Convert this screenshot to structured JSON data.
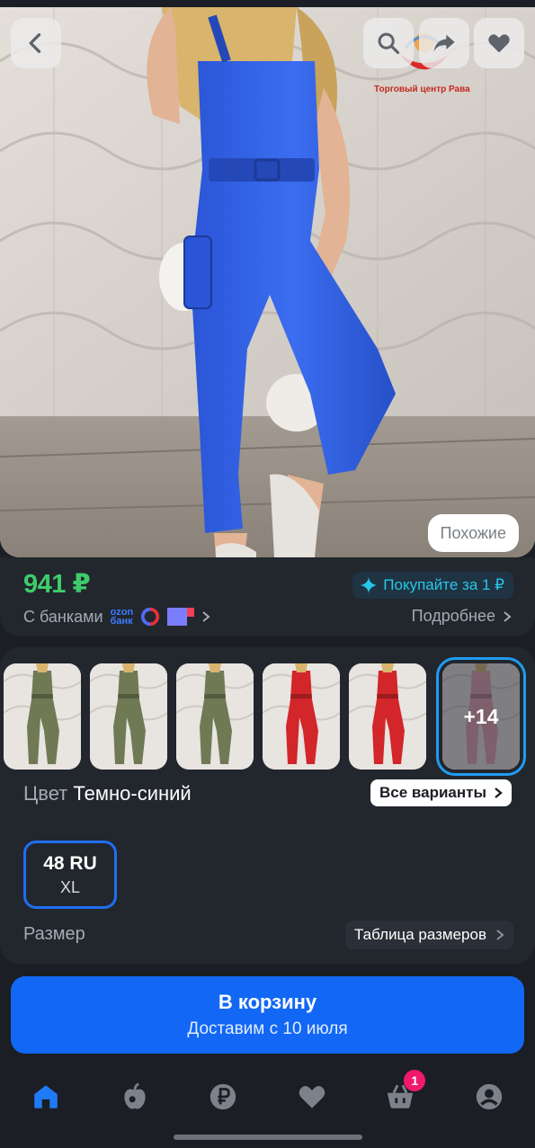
{
  "hero": {
    "seller_text": "Торговый центр Рава",
    "similar_label": "Похожие"
  },
  "price_card": {
    "price": "941 ₽",
    "promo_label": "Покупайте за 1 ₽",
    "banks_label": "С банками",
    "ozon_bank": [
      "ozon",
      "банк"
    ],
    "more_label": "Подробнее"
  },
  "variants": {
    "thumbnails": [
      {
        "color": "#6f7a55"
      },
      {
        "color": "#6f7a55"
      },
      {
        "color": "#6f7a55"
      },
      {
        "color": "#d2262a"
      },
      {
        "color": "#d2262a"
      },
      {
        "color": "#e7a1b0"
      }
    ],
    "more_count": "+14",
    "color_label": "Цвет",
    "color_value": "Темно-синий",
    "all_variants_label": "Все варианты",
    "size_ru": "48 RU",
    "size_intl": "XL",
    "size_label": "Размер",
    "size_table_label": "Таблица размеров"
  },
  "cart": {
    "title": "В корзину",
    "delivery": "Доставим с 10 июля"
  },
  "nav": {
    "items": [
      "home",
      "fresh",
      "finance",
      "favorites",
      "cart",
      "profile"
    ],
    "cart_badge": "1"
  },
  "colors": {
    "accent": "#1268f5",
    "price_green": "#3ecc6a",
    "promo_cyan": "#28c6e8",
    "badge": "#f0196e",
    "selected_outline": "#1f9cf0",
    "jumpsuit_blue": "#2f5fe0"
  }
}
